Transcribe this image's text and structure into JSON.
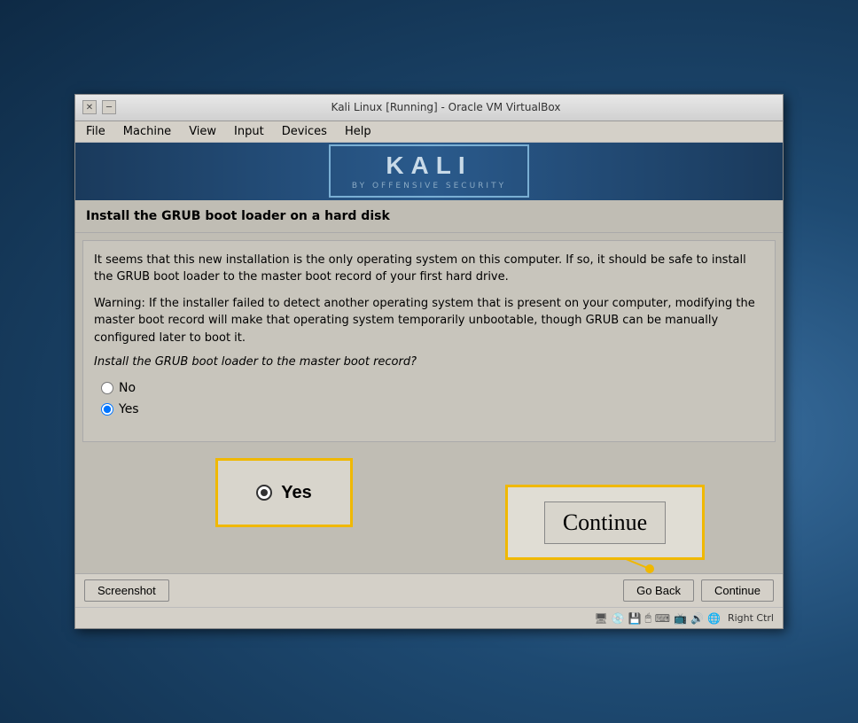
{
  "window": {
    "title": "Kali Linux [Running] - Oracle VM VirtualBox",
    "close_label": "✕",
    "minimize_label": "─"
  },
  "menu": {
    "items": [
      "File",
      "Machine",
      "View",
      "Input",
      "Devices",
      "Help"
    ]
  },
  "kali": {
    "logo_main": "KALI",
    "logo_sub": "BY OFFENSIVE SECURITY"
  },
  "installer": {
    "section_title": "Install the GRUB boot loader on a hard disk",
    "info_text": "It seems that this new installation is the only operating system on this computer. If so, it should be safe to install the GRUB boot loader to the master boot record of your first hard drive.",
    "warning_text": "Warning: If the installer failed to detect another operating system that is present on your computer, modifying the master boot record will make that operating system temporarily unbootable, though GRUB can be manually configured later to boot it.",
    "question_text": "Install the GRUB boot loader to the master boot record?",
    "options": [
      {
        "label": "No",
        "value": "no",
        "checked": false
      },
      {
        "label": "Yes",
        "value": "yes",
        "checked": true
      }
    ]
  },
  "callouts": {
    "yes_label": "Yes",
    "continue_label": "Continue"
  },
  "toolbar": {
    "screenshot_label": "Screenshot",
    "go_back_label": "Go Back",
    "continue_label": "Continue"
  },
  "status": {
    "right_ctrl": "Right Ctrl"
  }
}
